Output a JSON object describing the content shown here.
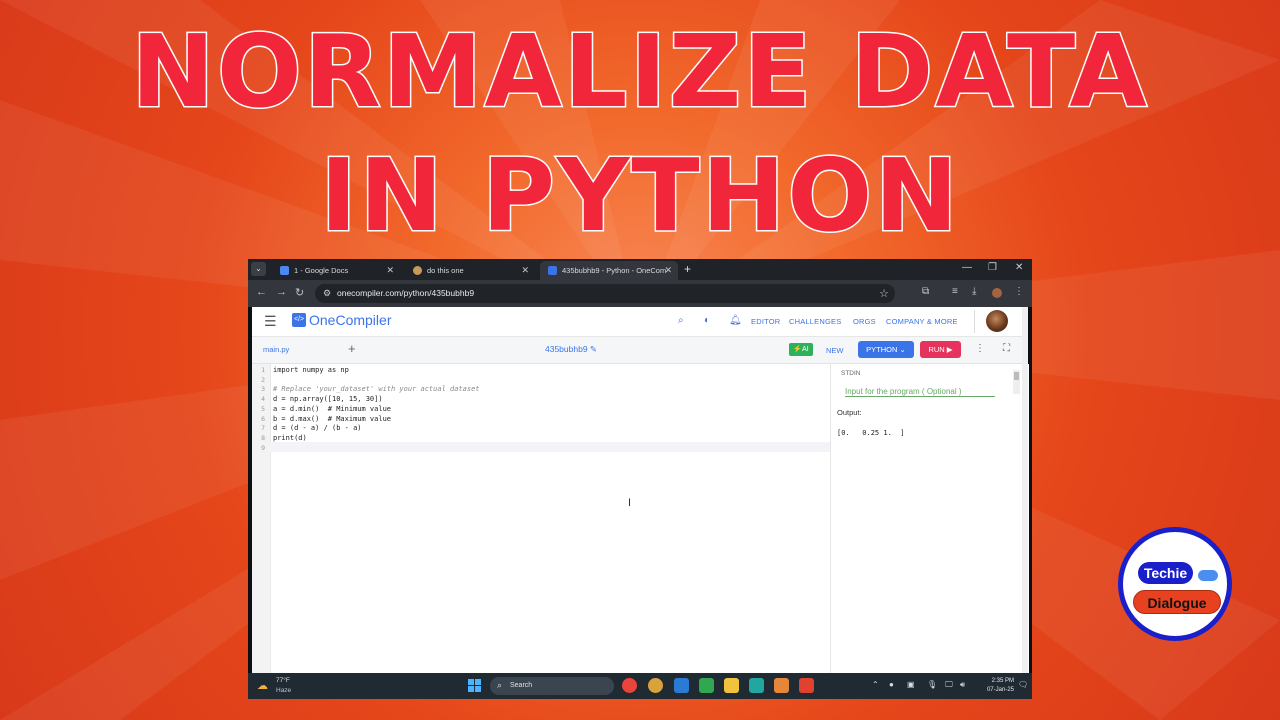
{
  "thumbnail": {
    "title_line1": "NORMALIZE DATA",
    "title_line2": "IN PYTHON",
    "accent_color": "#f2263a"
  },
  "browser": {
    "tabs": [
      {
        "label": "1 - Google Docs",
        "icon": "google-docs-icon",
        "active": false
      },
      {
        "label": "do this one",
        "icon": "page-icon",
        "active": false
      },
      {
        "label": "435bubhb9 - Python - OneCom",
        "icon": "onecompiler-icon",
        "active": true
      }
    ],
    "url": "onecompiler.com/python/435bubhb9"
  },
  "onecompiler": {
    "brand": "OneCompiler",
    "logo_text": "</>",
    "nav": [
      "EDITOR",
      "CHALLENGES",
      "ORGS",
      "COMPANY & MORE"
    ],
    "file_tab": "main.py",
    "project_name": "435bubhb9",
    "ai_label": "AI",
    "new_label": "NEW",
    "language": "PYTHON",
    "run_label": "RUN",
    "brand_color": "#3b74e8",
    "run_color": "#e6335d"
  },
  "editor": {
    "lines": [
      {
        "no": "1",
        "text": "import numpy as np",
        "type": "code"
      },
      {
        "no": "2",
        "text": "",
        "type": "code"
      },
      {
        "no": "3",
        "text": "# Replace 'your_dataset' with your actual dataset",
        "type": "comment"
      },
      {
        "no": "4",
        "text": "d = np.array([10, 15, 30])",
        "type": "code"
      },
      {
        "no": "5",
        "text": "a = d.min()  # Minimum value",
        "type": "code"
      },
      {
        "no": "6",
        "text": "b = d.max()  # Maximum value",
        "type": "code"
      },
      {
        "no": "7",
        "text": "d = (d - a) / (b - a)",
        "type": "code"
      },
      {
        "no": "8",
        "text": "print(d)",
        "type": "code"
      },
      {
        "no": "9",
        "text": "",
        "type": "code"
      }
    ]
  },
  "io_panel": {
    "stdin_label": "STDIN",
    "stdin_placeholder": "Input for the program ( Optional )",
    "output_label": "Output:",
    "output_text": "[0.   0.25 1.  ]"
  },
  "taskbar": {
    "temperature": "77°F",
    "condition": "Haze",
    "search_label": "Search",
    "time": "2:35 PM",
    "date": "07-Jan-25"
  },
  "badge": {
    "line1": "Techie",
    "line2": "Dialogue"
  }
}
